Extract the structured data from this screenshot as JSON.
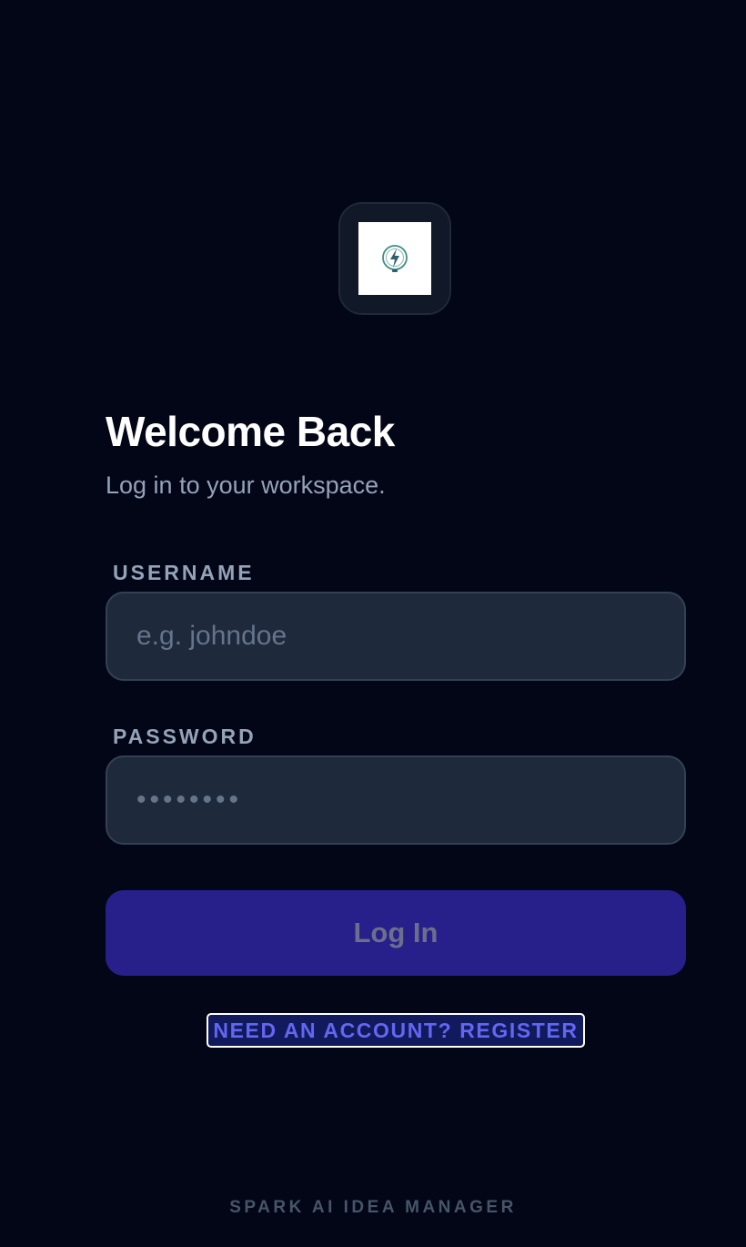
{
  "app": {
    "logo_icon": "bolt-bulb-icon"
  },
  "header": {
    "title": "Welcome Back",
    "subtitle": "Log in to your workspace."
  },
  "form": {
    "username_label": "USERNAME",
    "username_placeholder": "e.g. johndoe",
    "username_value": "",
    "password_label": "PASSWORD",
    "password_placeholder": "••••••••",
    "password_value": "",
    "submit_label": "Log In",
    "register_link": "NEED AN ACCOUNT? REGISTER"
  },
  "footer": {
    "text": "SPARK AI IDEA MANAGER"
  },
  "colors": {
    "background": "#030617",
    "accent": "#28208a",
    "link": "#6366f1"
  }
}
